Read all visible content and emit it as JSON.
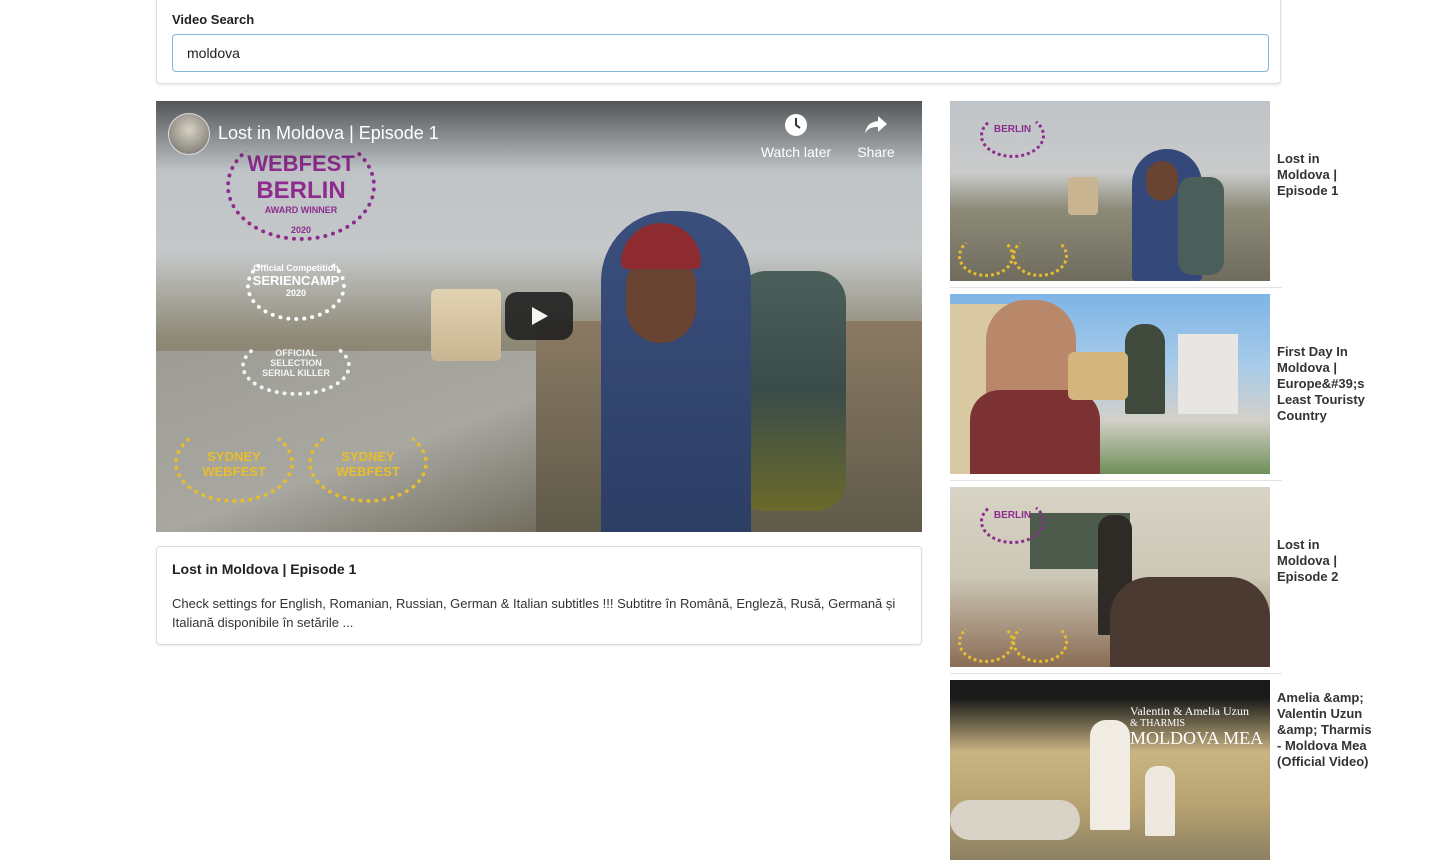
{
  "search": {
    "label": "Video Search",
    "value": "moldova"
  },
  "player": {
    "title": "Lost in Moldova | Episode 1",
    "watch_later_label": "Watch later",
    "share_label": "Share",
    "awards": {
      "webfest_line1": "WEBFEST",
      "webfest_line2": "BERLIN",
      "webfest_line3": "AWARD WINNER",
      "webfest_year": "2020",
      "seriencamp_line1": "Official Competition",
      "seriencamp_line2": "SERIENCAMP",
      "seriencamp_year": "2020",
      "killer_line1": "OFFICIAL",
      "killer_line2": "SELECTION",
      "killer_line3": "SERIAL KILLER",
      "sydney1": "SYDNEY WEBFEST",
      "sydney2": "SYDNEY WEBFEST"
    }
  },
  "detail": {
    "title": "Lost in Moldova | Episode 1",
    "description": "Check settings for English, Romanian, Russian, German & Italian subtitles !!! Subtitre în Română, Engleză, Rusă, Germană și Italiană disponibile în setările ..."
  },
  "video_list": [
    {
      "title": "Lost in Moldova | Episode 1"
    },
    {
      "title": "First Day In Moldova | Europe&#39;s Least Touristy Country"
    },
    {
      "title": "Lost in Moldova | Episode 2"
    },
    {
      "title": "Amelia &amp; Valentin Uzun &amp; Tharmis - Moldova Mea (Official Video)"
    }
  ],
  "thumb4_text": {
    "line1": "Valentin & Amelia Uzun",
    "line2": "& THARMIS",
    "line3": "MOLDOVA MEA"
  },
  "colors": {
    "input_border": "#85b7d9",
    "webfest_purple": "#8e2c8e",
    "sydney_gold": "#e8bd2c"
  }
}
